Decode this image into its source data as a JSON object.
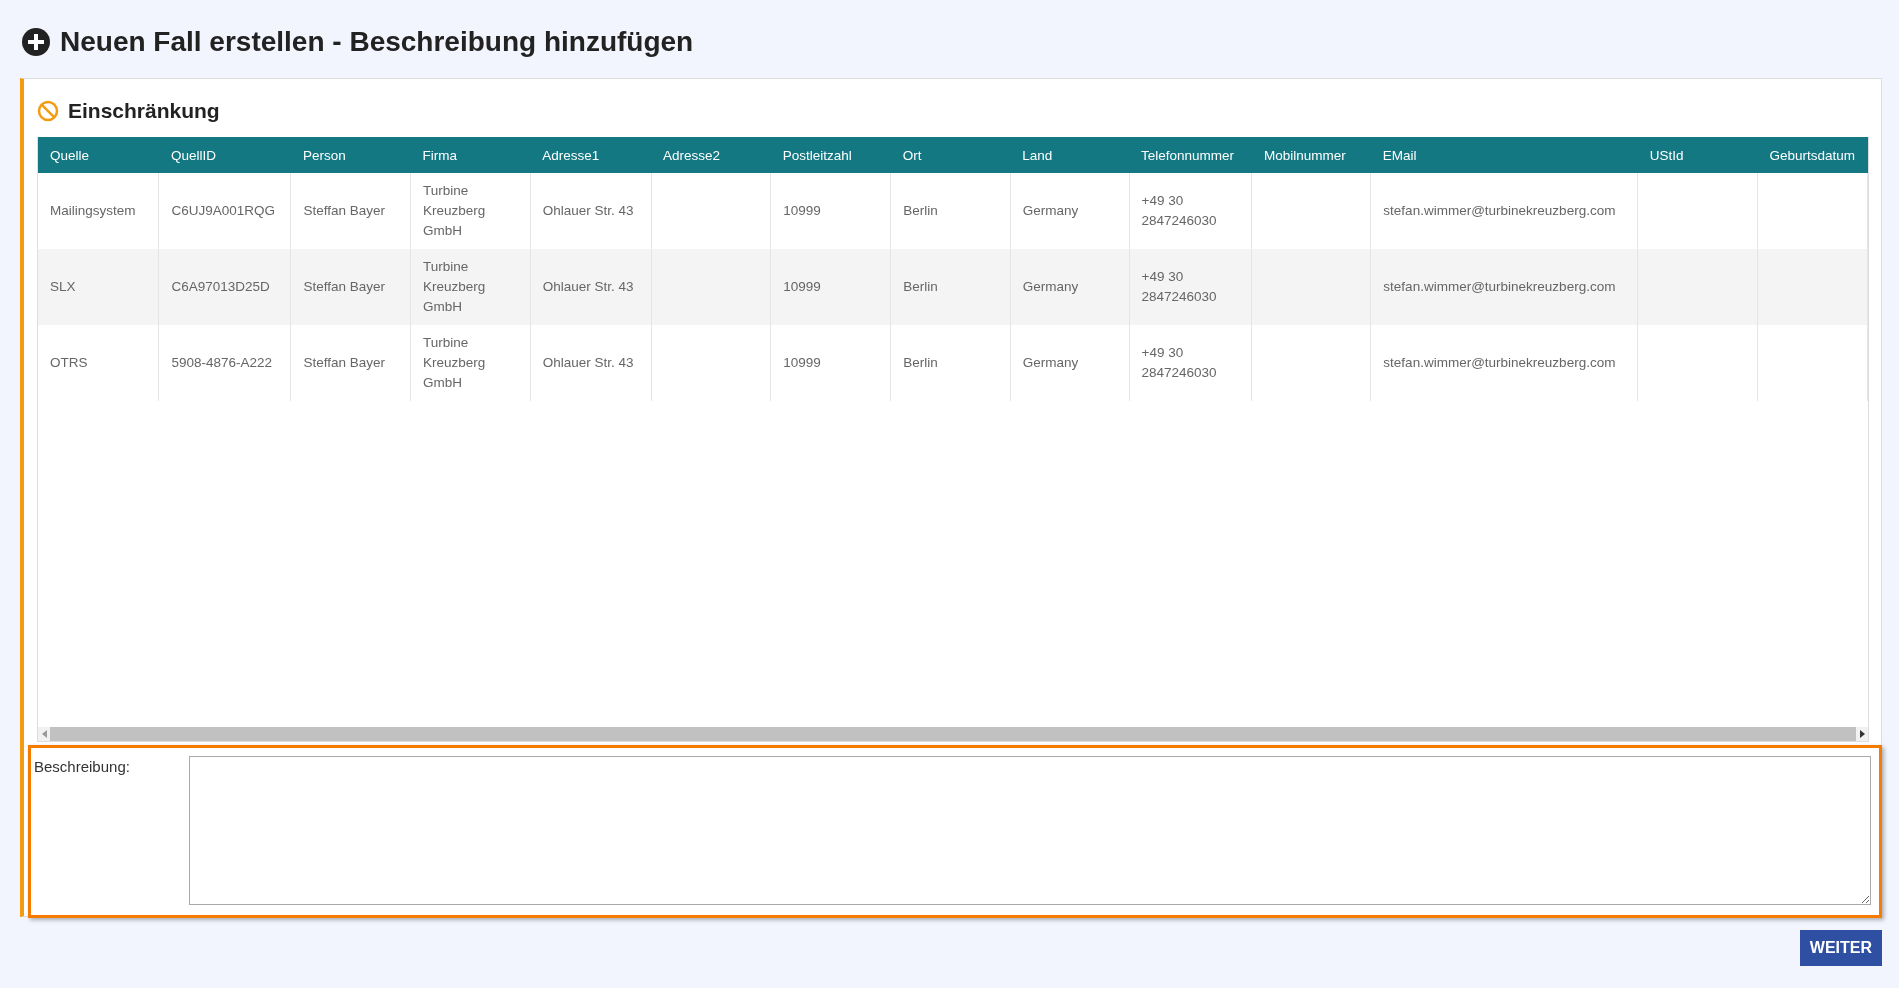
{
  "page_title": "Neuen Fall erstellen - Beschreibung hinzufügen",
  "section": {
    "title": "Einschränkung"
  },
  "table": {
    "columns": [
      "Quelle",
      "QuellID",
      "Person",
      "Firma",
      "Adresse1",
      "Adresse2",
      "Postleitzahl",
      "Ort",
      "Land",
      "Telefonnummer",
      "Mobilnummer",
      "EMail",
      "UStId",
      "Geburtsdatum"
    ],
    "rows": [
      {
        "selected": false,
        "cells": [
          "Mailingsystem",
          "C6UJ9A001RQG",
          "Steffan Bayer",
          "Turbine Kreuzberg GmbH",
          "Ohlauer Str. 43",
          "",
          "10999",
          "Berlin",
          "Germany",
          "+49 30 2847246030",
          "",
          "stefan.wimmer@turbinekreuzberg.com",
          "",
          ""
        ]
      },
      {
        "selected": false,
        "cells": [
          "SLX",
          "C6A97013D25D",
          "Steffan Bayer",
          "Turbine Kreuzberg GmbH",
          "Ohlauer Str. 43",
          "",
          "10999",
          "Berlin",
          "Germany",
          "+49 30 2847246030",
          "",
          "stefan.wimmer@turbinekreuzberg.com",
          "",
          ""
        ]
      },
      {
        "selected": false,
        "cells": [
          "OTRS",
          "5908-4876-A222",
          "Steffan Bayer",
          "Turbine Kreuzberg GmbH",
          "Ohlauer Str. 43",
          "",
          "10999",
          "Berlin",
          "Germany",
          "+49 30 2847246030",
          "",
          "stefan.wimmer@turbinekreuzberg.com",
          "",
          ""
        ]
      }
    ]
  },
  "description": {
    "label": "Beschreibung:"
  },
  "buttons": [
    "WEITER"
  ]
}
